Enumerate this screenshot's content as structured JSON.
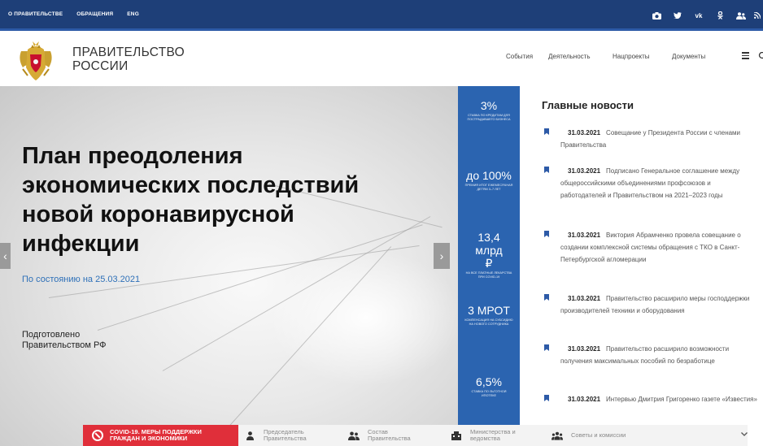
{
  "topbar": {
    "links": [
      "О ПРАВИТЕЛЬСТВЕ",
      "ОБРАЩЕНИЯ",
      "ENG"
    ],
    "social_icons": [
      "camera-icon",
      "twitter-icon",
      "vk-icon",
      "odnoklassniki-icon",
      "users-icon",
      "rss-icon"
    ]
  },
  "header": {
    "brand_line1": "ПРАВИТЕЛЬСТВО",
    "brand_line2": "РОССИИ",
    "nav": [
      "События",
      "Деятельность",
      "Нацпроекты",
      "Документы"
    ]
  },
  "hero": {
    "title_lines": [
      "План преодоления",
      "экономических последствий",
      "новой коронавирусной",
      "инфекции"
    ],
    "date": "По состоянию на 25.03.2021",
    "credit_line1": "Подготовлено",
    "credit_line2": "Правительством РФ",
    "prev_arrow": "‹",
    "next_arrow": "›"
  },
  "stats": [
    {
      "value": "3%",
      "desc": "СТАВКА ПО КРЕДИТАМ ДЛЯ ПОСТРАДАВШЕГО БИЗНЕСА"
    },
    {
      "value": "до 100%",
      "desc": "ПРЕМИЯ ИТОГ ЕЖЕМЕСЯЧНАЯ ДЕТЯМ 3–7 ЛЕТ"
    },
    {
      "value": "13,4 млрд ₽",
      "desc": "НА ВСЕ ПЛАТНЫЕ ЛЕКАРСТВА ПРИ COVID-19"
    },
    {
      "value": "3 МРОТ",
      "desc": "КОМПЕНСАЦИЯ НА СУБСИДИЮ НА НОВОГО СОТРУДНИКА"
    },
    {
      "value": "6,5%",
      "desc": "СТАВКА ПО ЛЬГОТНОЙ ИПОТЕКЕ"
    }
  ],
  "news": {
    "heading": "Главные новости",
    "items": [
      {
        "date": "31.03.2021",
        "text": "Совещание у Президента России с членами Правительства"
      },
      {
        "date": "31.03.2021",
        "text": "Подписано Генеральное соглашение между общероссийскими объединениями профсоюзов и работодателей и Правительством на 2021–2023 годы"
      },
      {
        "date": "31.03.2021",
        "text": "Виктория Абрамченко провела совещание о создании комплексной системы обращения с ТКО в Санкт-Петербургской агломерации"
      },
      {
        "date": "31.03.2021",
        "text": "Правительство расширило меры господдержки производителей техники и оборудования"
      },
      {
        "date": "31.03.2021",
        "text": "Правительство расширило возможности получения максимальных пособий по безработице"
      },
      {
        "date": "31.03.2021",
        "text": "Интервью Дмитрия Григоренко газете «Известия»"
      }
    ]
  },
  "bottom": {
    "covid_line1": "COVID-19. МЕРЫ ПОДДЕРЖКИ",
    "covid_line2": "ГРАЖДАН И ЭКОНОМИКИ",
    "links": [
      {
        "l1": "Председатель",
        "l2": "Правительства",
        "icon": "person-icon"
      },
      {
        "l1": "Состав",
        "l2": "Правительства",
        "icon": "group-icon"
      },
      {
        "l1": "Министерства и",
        "l2": "ведомства",
        "icon": "building-icon"
      },
      {
        "l1": "Советы и комиссии",
        "l2": "",
        "icon": "council-icon"
      }
    ]
  },
  "colors": {
    "topbar": "#1e3f78",
    "stats": "#2b64b0",
    "covid": "#e02f3a",
    "date_link": "#2e70b8"
  }
}
